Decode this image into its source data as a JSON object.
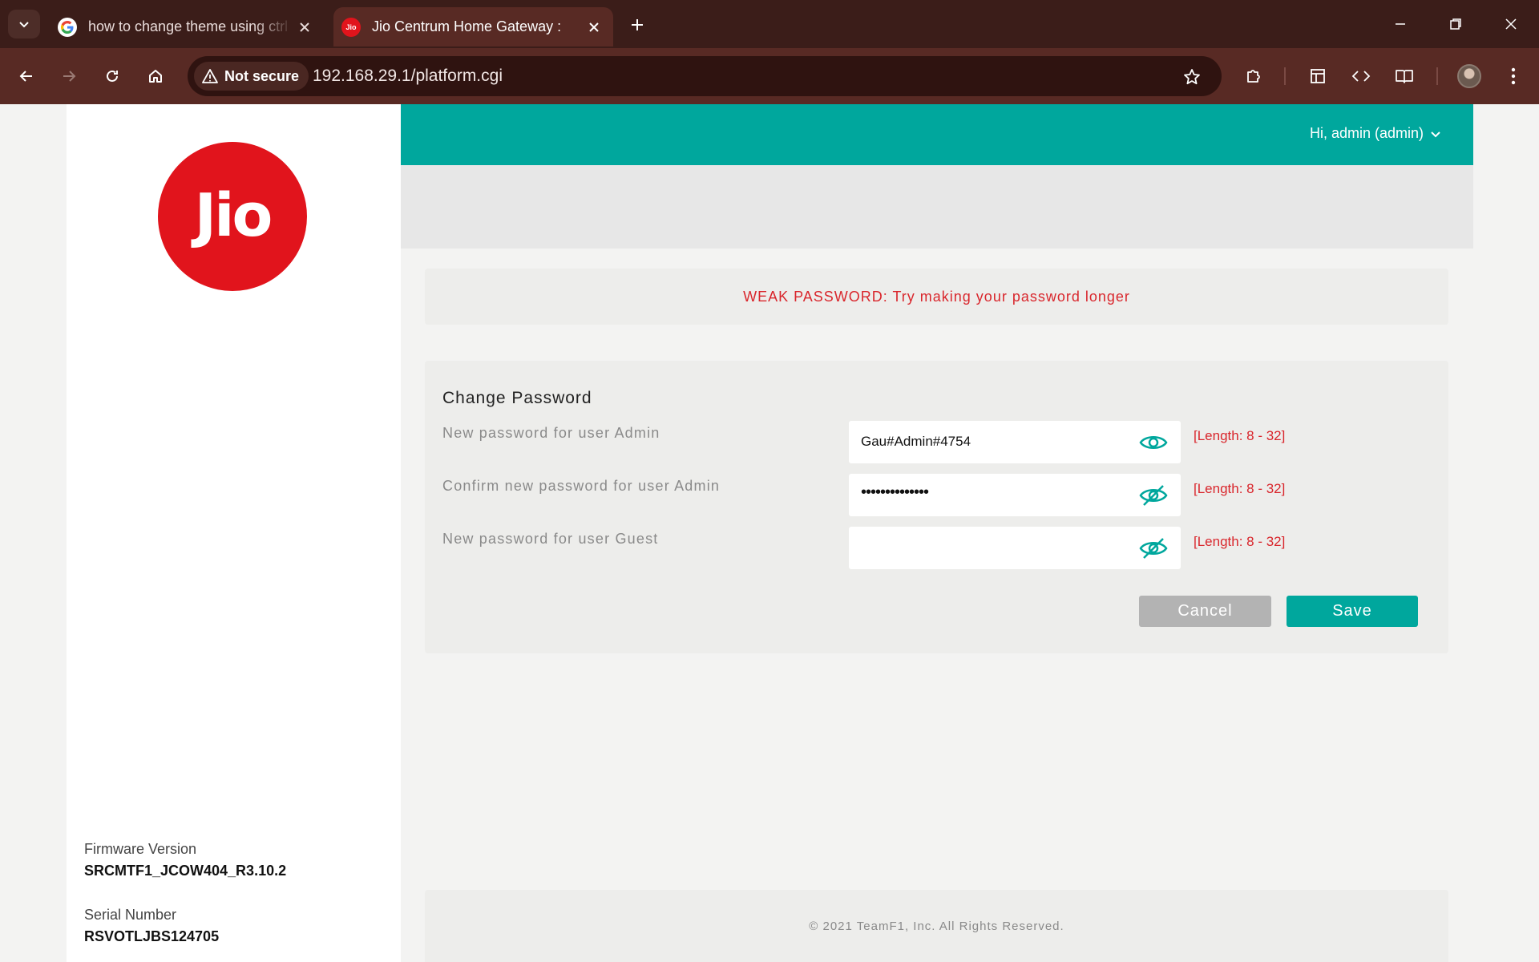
{
  "browser": {
    "tabs": [
      {
        "title": "how to change theme using ctrl",
        "favicon": "google-g-icon",
        "active": false
      },
      {
        "title": "Jio Centrum Home Gateway :",
        "favicon": "jio-favicon",
        "favicon_text": "Jio",
        "active": true
      }
    ],
    "security_chip": "Not secure",
    "url": "192.168.29.1/platform.cgi"
  },
  "colors": {
    "brand_teal": "#00a79d",
    "jio_red": "#e1141c",
    "error_red": "#d9262c",
    "chrome_dark": "#3b1d19",
    "chrome_toolbar": "#582a24"
  },
  "sidebar": {
    "logo_text": "Jio",
    "firmware_label": "Firmware Version",
    "firmware_value": "SRCMTF1_JCOW404_R3.10.2",
    "serial_label": "Serial Number",
    "serial_value": "RSVOTLJBS124705"
  },
  "header": {
    "user_menu": "Hi, admin (admin)"
  },
  "alert": {
    "message": "WEAK PASSWORD: Try making your password longer"
  },
  "change_password": {
    "title": "Change Password",
    "rows": [
      {
        "label": "New password for user Admin",
        "value": "Gau#Admin#4754",
        "masked": false,
        "hint": "[Length: 8 - 32]"
      },
      {
        "label": "Confirm new password for user Admin",
        "value": "••••••••••••••",
        "masked": true,
        "hint": "[Length: 8 - 32]"
      },
      {
        "label": "New password for user Guest",
        "value": "",
        "masked": true,
        "hint": "[Length: 8 - 32]"
      }
    ],
    "cancel_label": "Cancel",
    "save_label": "Save"
  },
  "footer": {
    "copyright": "© 2021 TeamF1, Inc. All Rights Reserved."
  }
}
